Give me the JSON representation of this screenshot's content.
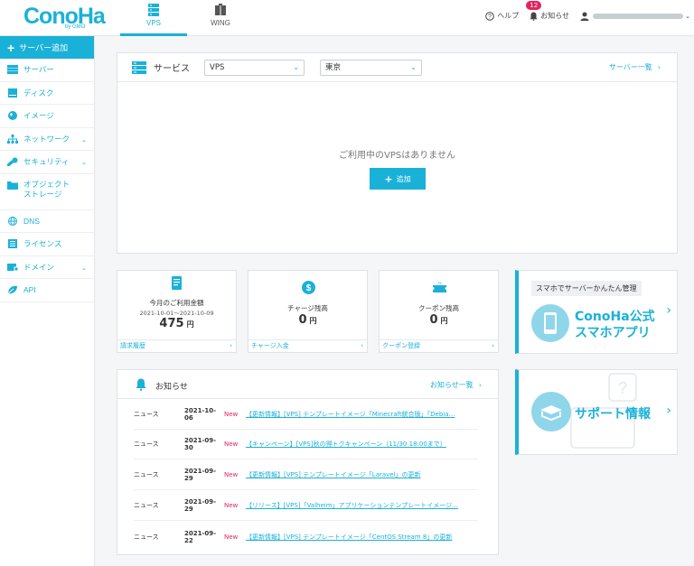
{
  "header": {
    "logo": "ConoHa",
    "logo_sub": "by GMO",
    "tabs": [
      {
        "label": "VPS"
      },
      {
        "label": "WING"
      }
    ],
    "help": "ヘルプ",
    "notifications": "お知らせ",
    "notification_count": "12"
  },
  "sidebar": {
    "add": "サーバー追加",
    "items": [
      {
        "label": "サーバー"
      },
      {
        "label": "ディスク"
      },
      {
        "label": "イメージ"
      },
      {
        "label": "ネットワーク"
      },
      {
        "label": "セキュリティ"
      },
      {
        "label": "オブジェクト",
        "label2": "ストレージ"
      },
      {
        "label": "DNS"
      },
      {
        "label": "ライセンス"
      },
      {
        "label": "ドメイン"
      },
      {
        "label": "API"
      }
    ]
  },
  "service": {
    "title": "サービス",
    "type_select": "VPS",
    "region_select": "東京",
    "list_link": "サーバー一覧",
    "empty_message": "ご利用中のVPSはありません",
    "add_button": "追加"
  },
  "billing": {
    "title": "今月のご利用金額",
    "range": "2021-10-01～2021-10-09",
    "amount": "475",
    "unit": "円",
    "link": "請求履歴"
  },
  "charge": {
    "title": "チャージ残高",
    "amount": "0",
    "unit": "円",
    "link": "チャージ入金"
  },
  "coupon": {
    "title": "クーポン残高",
    "amount": "0",
    "unit": "円",
    "link": "クーポン登録"
  },
  "app_promo": {
    "tag": "スマホでサーバーかんたん管理",
    "line1": "ConoHa公式",
    "line2": "スマホアプリ"
  },
  "support_promo": {
    "label": "サポート情報"
  },
  "news": {
    "title": "お知らせ",
    "list_link": "お知らせ一覧",
    "items": [
      {
        "category": "ニュース",
        "date": "2021-10-06",
        "new": "New",
        "title": "【更新情報】[VPS] テンプレートイメージ「Minecraft統合版」「Debia…"
      },
      {
        "category": "ニュース",
        "date": "2021-09-30",
        "new": "New",
        "title": "【キャンペーン】[VPS]秋の得トクキャンペーン（11/30 18:00まで）"
      },
      {
        "category": "ニュース",
        "date": "2021-09-29",
        "new": "New",
        "title": "【更新情報】[VPS] テンプレートイメージ「Laravel」の更新"
      },
      {
        "category": "ニュース",
        "date": "2021-09-29",
        "new": "New",
        "title": "【リリース】[VPS]「Valheim」アプリケーションテンプレートイメージ…"
      },
      {
        "category": "ニュース",
        "date": "2021-09-22",
        "new": "New",
        "title": "【更新情報】[VPS] テンプレートイメージ「CentOS Stream 8」の更新"
      }
    ]
  },
  "colors": {
    "accent": "#1ab1d8",
    "new": "#e2245d"
  }
}
